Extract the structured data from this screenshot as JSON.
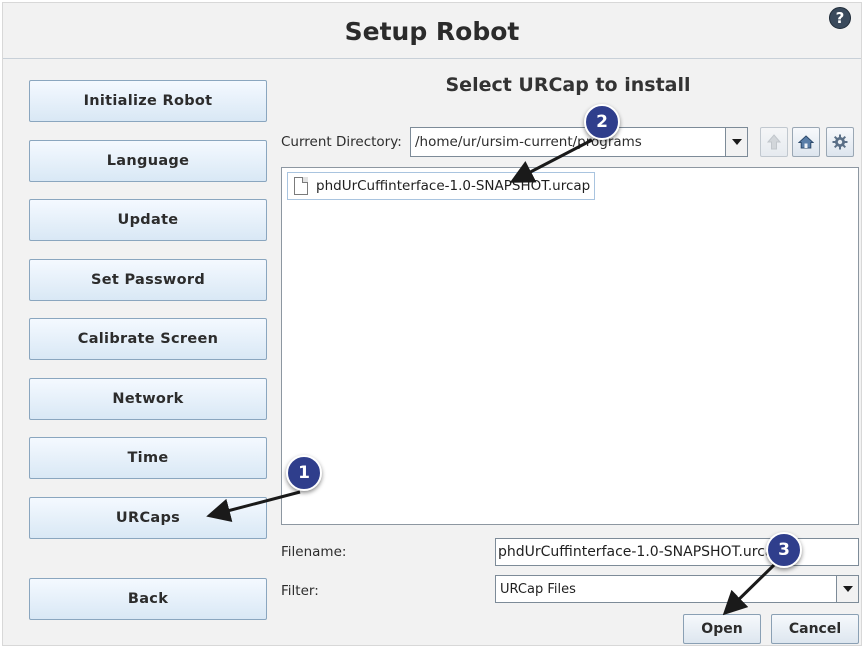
{
  "window": {
    "title": "Setup Robot",
    "help_icon": "?"
  },
  "sidebar": {
    "items": [
      {
        "label": "Initialize Robot"
      },
      {
        "label": "Language"
      },
      {
        "label": "Update"
      },
      {
        "label": "Set Password"
      },
      {
        "label": "Calibrate Screen"
      },
      {
        "label": "Network"
      },
      {
        "label": "Time"
      },
      {
        "label": "URCaps"
      }
    ],
    "back_label": "Back"
  },
  "file_dialog": {
    "title": "Select URCap to install",
    "current_directory_label": "Current Directory:",
    "current_directory_value": "/home/ur/ursim-current/programs",
    "toolbar_icons": [
      "up-arrow-icon",
      "home-icon",
      "gear-icon"
    ],
    "files": [
      {
        "name": "phdUrCuffinterface-1.0-SNAPSHOT.urcap",
        "icon": "file-icon"
      }
    ],
    "filename_label": "Filename:",
    "filename_value": "phdUrCuffinterface-1.0-SNAPSHOT.urcap",
    "filter_label": "Filter:",
    "filter_value": "URCap Files",
    "open_label": "Open",
    "cancel_label": "Cancel"
  },
  "annotations": [
    {
      "number": "1",
      "target": "URCaps"
    },
    {
      "number": "2",
      "target": "phdUrCuffinterface-1.0-SNAPSHOT.urcap"
    },
    {
      "number": "3",
      "target": "Open"
    }
  ],
  "colors": {
    "button_top": "#f4f9ff",
    "button_bottom": "#d9e8f5",
    "button_border": "#8aa6bf",
    "badge": "#2f3e8c"
  }
}
